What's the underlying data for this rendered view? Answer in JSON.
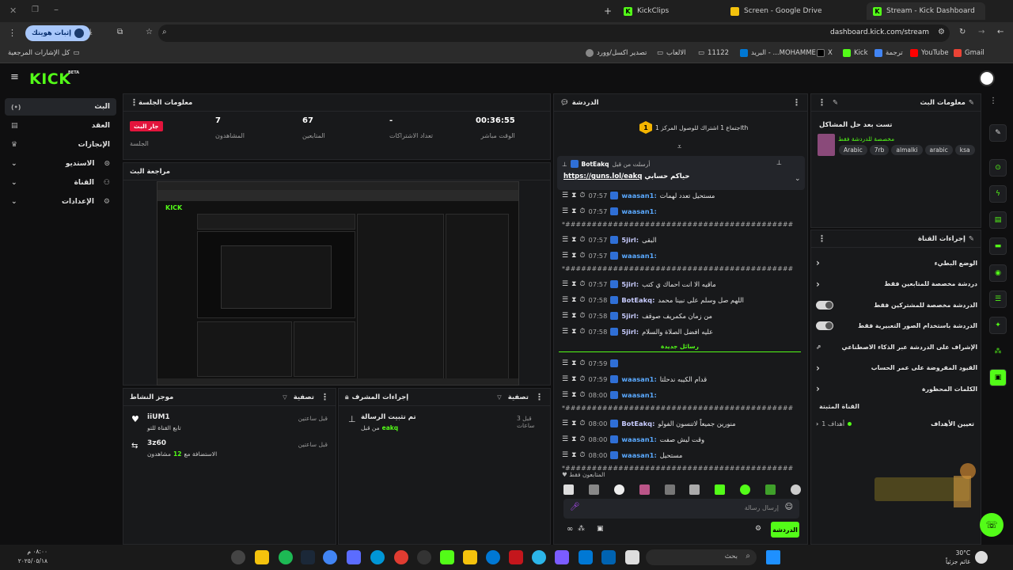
{
  "browser": {
    "tabs": [
      {
        "label": "Stream - Kick Dashboard",
        "active": true
      },
      {
        "label": "Screen - Google Drive",
        "active": false
      },
      {
        "label": "KickClips",
        "active": false
      }
    ],
    "url": "dashboard.kick.com/stream",
    "profile_button": "إثبات هويتك",
    "bookmarks": {
      "all": "كل الإشارات المرجعية",
      "items": [
        "Gmail",
        "YouTube",
        "ترجمة",
        "Kick",
        "X",
        "البريد - ...MOHAMME",
        "11122",
        "الالعاب",
        "تصدير اكسل/وورد"
      ]
    }
  },
  "colors": {
    "accent": "#53fc18",
    "panel": "#18191b",
    "bg": "#0f0f10"
  },
  "sidebar": {
    "items": [
      {
        "label": "البث",
        "icon": "broadcast-icon",
        "active": true
      },
      {
        "label": "العقد",
        "icon": "contract-icon"
      },
      {
        "label": "الإنجازات",
        "icon": "trophy-icon"
      },
      {
        "label": "الاستديو",
        "icon": "studio-icon",
        "expand": true
      },
      {
        "label": "القناة",
        "icon": "channel-icon",
        "expand": true
      },
      {
        "label": "الإعدادات",
        "icon": "gear-icon",
        "expand": true
      }
    ]
  },
  "session": {
    "title": "معلومات الجلسة",
    "live_badge": "جار البث",
    "session_label": "الجلسة",
    "stats": [
      {
        "value": "00:36:55",
        "label": "الوقت مباشر"
      },
      {
        "value": "-",
        "label": "تعداد الاشتراكات"
      },
      {
        "value": "67",
        "label": "المتابعين"
      },
      {
        "value": "7",
        "label": "المشاهدون"
      }
    ]
  },
  "preview": {
    "title": "مراجعة البث"
  },
  "activity": {
    "title": "موجز النشاط",
    "filter": "تصفية",
    "items": [
      {
        "name": "iiUM1",
        "desc": "تابع القناة للتو",
        "time": "قبل ساعتين"
      },
      {
        "name": "3z60",
        "desc_pre": "الاستضافة مع",
        "count": "12",
        "desc_post": "مشاهدون",
        "time": "قبل ساعتين"
      }
    ]
  },
  "mod": {
    "title": "إجراءات المشرف",
    "filter": "تصفية",
    "item": {
      "title": "تم تثبيت الرسالة",
      "by_pre": "من قبل",
      "by_user": "eakq",
      "time": "قبل 3 ساعات"
    }
  },
  "chat": {
    "title": "الدردشة",
    "goal_text": "اجتماع 1 اشتراك للوصول المركز 1th",
    "goal_num": "1",
    "pinned": {
      "sent_by": "أرسلت من قبل",
      "user": "BotEakq",
      "text": "حياكم حسابي",
      "link": "https://guns.lol/eakq"
    },
    "messages": [
      {
        "time": "07:57",
        "user": "waasan1:",
        "text": "مستحيل تعدد لهمات"
      },
      {
        "time": "07:57",
        "user": "waasan1:",
        "text": ""
      },
      {
        "sep": "*#######################################################"
      },
      {
        "time": "07:57",
        "user": "5jirl:",
        "text": "البقى",
        "w": true
      },
      {
        "time": "07:57",
        "user": "waasan1:",
        "text": ""
      },
      {
        "sep": "*#######################################################"
      },
      {
        "time": "07:57",
        "user": "5jirl:",
        "text": "ماقيه الا انت احماك ي كتب",
        "w": true
      },
      {
        "time": "07:58",
        "user": "BotEakq:",
        "text": "اللهم صل وسلم على نبينا محمد",
        "w": true
      },
      {
        "time": "07:58",
        "user": "5jirl:",
        "text": "من زمان مكمريف صوقف",
        "w": true
      },
      {
        "time": "07:58",
        "user": "5jirl:",
        "text": "عليه افضل الصلاة والسلام",
        "w": true
      }
    ],
    "new_messages": "رسائل جديدة",
    "messages2": [
      {
        "time": "07:59",
        "user": "",
        "text": ""
      },
      {
        "time": "07:59",
        "user": "waasan1:",
        "text": "قدام الكيبه ندحلتا"
      },
      {
        "time": "08:00",
        "user": "waasan1:",
        "text": ""
      },
      {
        "sep": "*#######################################################"
      },
      {
        "time": "08:00",
        "user": "BotEakq:",
        "text": "منورين جميعاً لاتنسون الفولو",
        "w": true
      },
      {
        "time": "08:00",
        "user": "waasan1:",
        "text": "وقت ليش صفت"
      },
      {
        "time": "08:00",
        "user": "waasan1:",
        "text": "مستحيل"
      },
      {
        "sep": "*#######################################################"
      }
    ],
    "followers_only": "المتابعون فقط",
    "placeholder": "إرسال رسالة",
    "send": "الدردشة"
  },
  "stream_info": {
    "title": "معلومات البث",
    "stream_title": "تست بعد حل المشاكل",
    "category": "مخصصة للدردشة فقط",
    "tags": [
      "ksa",
      "arabic",
      "almalki",
      "7rb",
      "Arabic"
    ]
  },
  "channel_actions": {
    "title": "إجراءات القناة",
    "items": [
      {
        "label": "الوضع البطيء",
        "kind": "arrow"
      },
      {
        "label": "دردشة مخصصة للمتابعين فقط",
        "kind": "arrow"
      },
      {
        "label": "الدردشة مخصصة للمشتركين فقط",
        "kind": "toggle"
      },
      {
        "label": "الدردشة باستخدام الصور التعبيرية فقط",
        "kind": "toggle"
      },
      {
        "label": "الإشراف على الدردشة عبر الذكاء الاصطناعي",
        "kind": "ext"
      },
      {
        "label": "القيود المفروضة على عمر الحساب",
        "kind": "arrow"
      },
      {
        "label": "الكلمات المحظورة",
        "kind": "arrow"
      }
    ],
    "pinned_section": "القناة المثبتة",
    "goals_label": "تعيين الأهداف",
    "goals_value": "1 أهداف"
  },
  "taskbar": {
    "search": "بحث",
    "weather_temp": "30°C",
    "weather_desc": "غائم جزئياً",
    "time": "٠٨:٠٠ م",
    "date": "٢٠٢٥/٠٥/١٨"
  }
}
